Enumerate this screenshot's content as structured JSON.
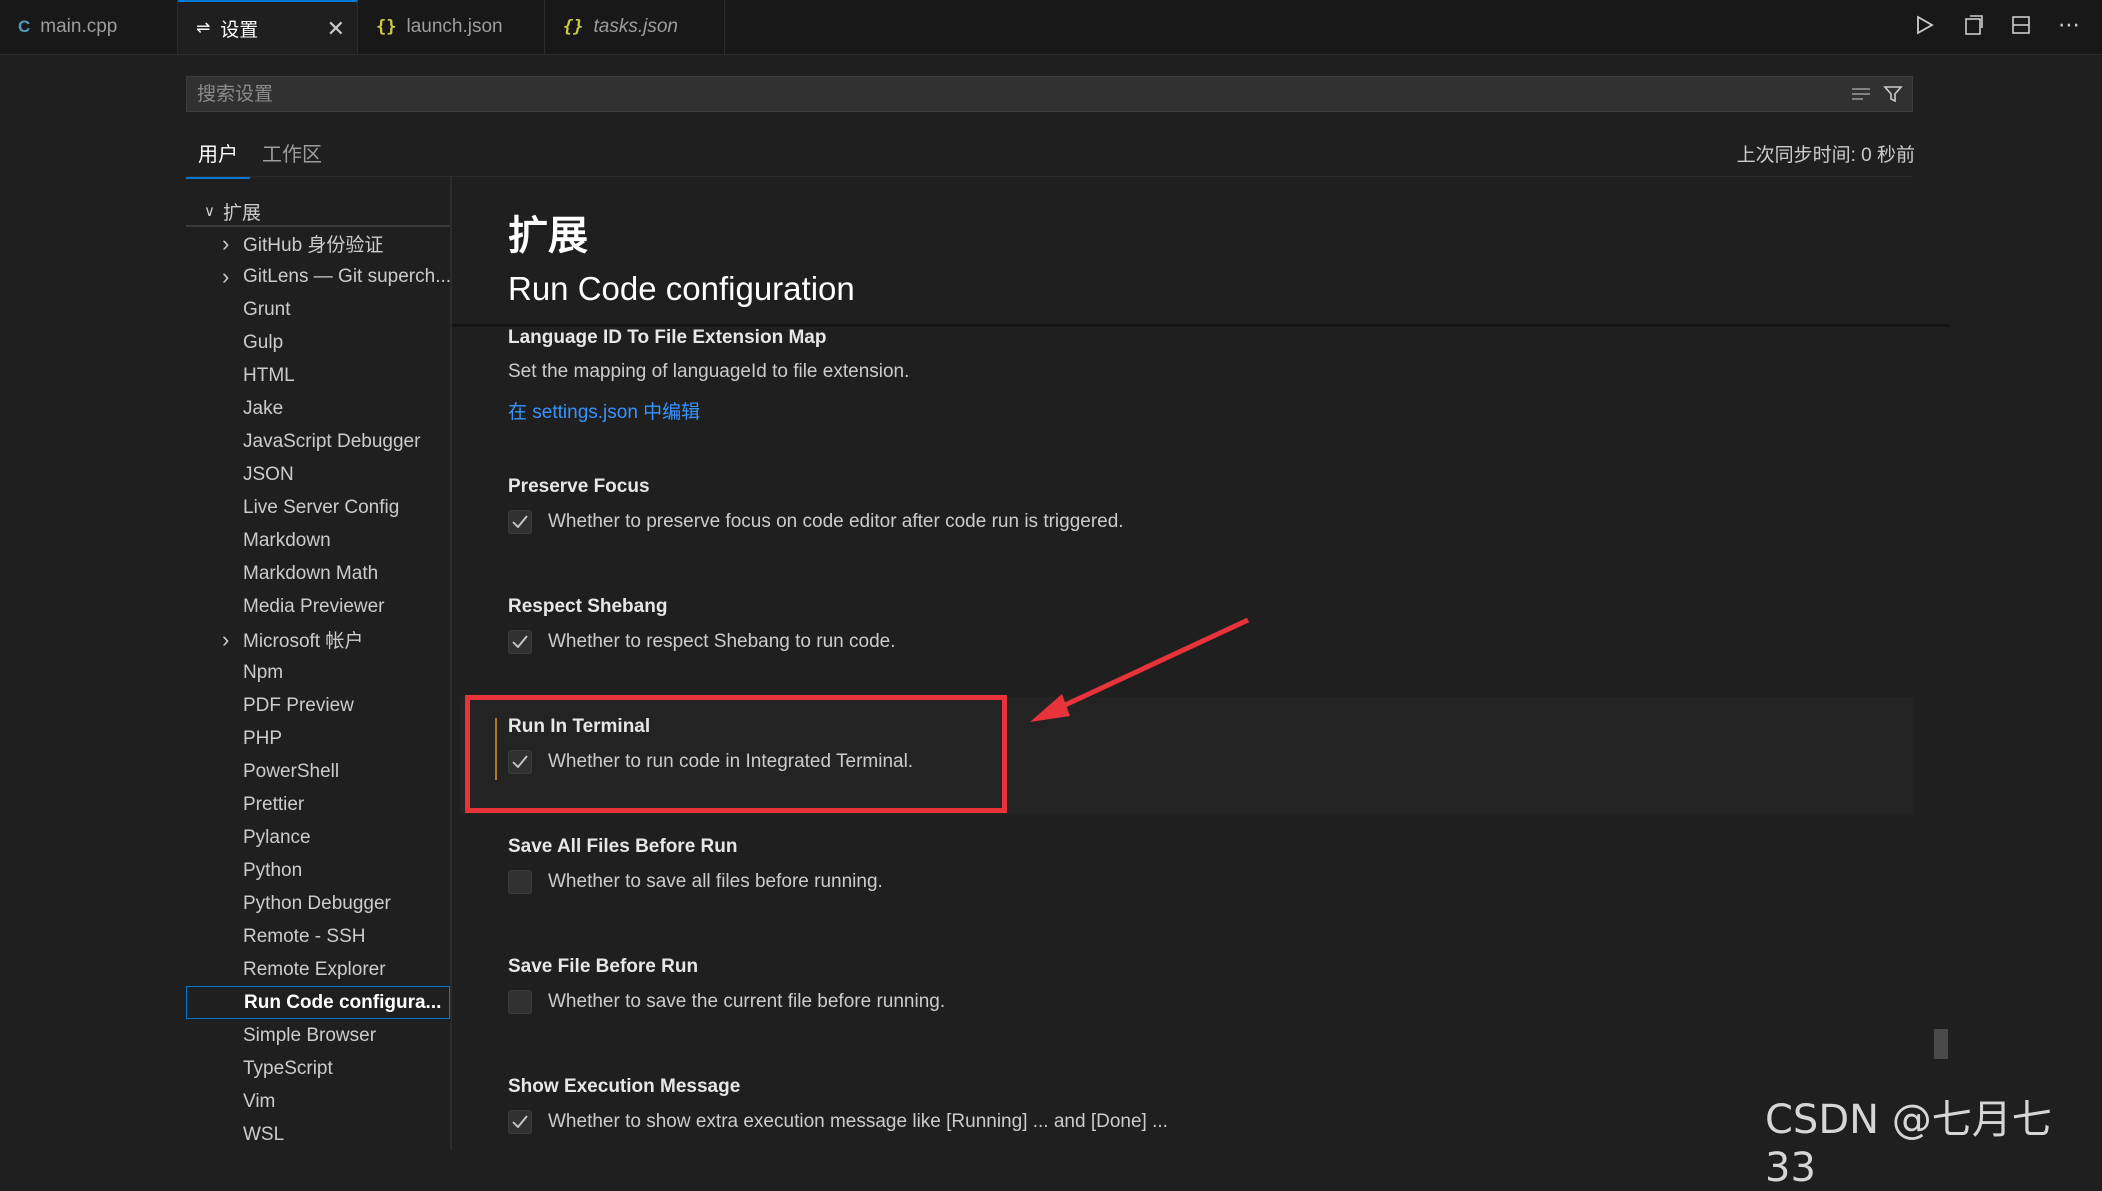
{
  "tabs": [
    {
      "label": "main.cpp",
      "icon": "cpp-file-icon"
    },
    {
      "label": "设置",
      "icon": "settings-sliders-icon",
      "active": true
    },
    {
      "label": "launch.json",
      "icon": "json-braces-icon"
    },
    {
      "label": "tasks.json",
      "icon": "json-braces-icon"
    }
  ],
  "search": {
    "placeholder": "搜索设置"
  },
  "scope_tabs": [
    "用户",
    "工作区"
  ],
  "sync_status": "上次同步时间: 0 秒前",
  "toc": {
    "group": "扩展",
    "items": [
      {
        "label": "GitHub 身份验证",
        "expandable": true
      },
      {
        "label": "GitLens — Git superch...",
        "expandable": true
      },
      {
        "label": "Grunt"
      },
      {
        "label": "Gulp"
      },
      {
        "label": "HTML"
      },
      {
        "label": "Jake"
      },
      {
        "label": "JavaScript Debugger"
      },
      {
        "label": "JSON"
      },
      {
        "label": "Live Server Config"
      },
      {
        "label": "Markdown"
      },
      {
        "label": "Markdown Math"
      },
      {
        "label": "Media Previewer"
      },
      {
        "label": "Microsoft 帐户",
        "expandable": true
      },
      {
        "label": "Npm"
      },
      {
        "label": "PDF Preview"
      },
      {
        "label": "PHP"
      },
      {
        "label": "PowerShell"
      },
      {
        "label": "Prettier"
      },
      {
        "label": "Pylance"
      },
      {
        "label": "Python"
      },
      {
        "label": "Python Debugger"
      },
      {
        "label": "Remote - SSH"
      },
      {
        "label": "Remote Explorer"
      },
      {
        "label": "Run Code configura...",
        "selected": true
      },
      {
        "label": "Simple Browser"
      },
      {
        "label": "TypeScript"
      },
      {
        "label": "Vim"
      },
      {
        "label": "WSL"
      }
    ]
  },
  "main": {
    "section_title": "扩展",
    "sub_title": "Run Code configuration",
    "settings": [
      {
        "title": "Language ID To File Extension Map",
        "description": "Set the mapping of languageId to file extension.",
        "link": "在 settings.json 中编辑"
      },
      {
        "title": "Preserve Focus",
        "description": "Whether to preserve focus on code editor after code run is triggered.",
        "checked": true
      },
      {
        "title": "Respect Shebang",
        "description": "Whether to respect Shebang to run code.",
        "checked": true
      },
      {
        "title": "Run In Terminal",
        "description": "Whether to run code in Integrated Terminal.",
        "checked": true
      },
      {
        "title": "Save All Files Before Run",
        "description": "Whether to save all files before running.",
        "checked": false
      },
      {
        "title": "Save File Before Run",
        "description": "Whether to save the current file before running.",
        "checked": false
      },
      {
        "title": "Show Execution Message",
        "description": "Whether to show extra execution message like [Running] ... and [Done] ...",
        "checked": true
      }
    ]
  },
  "watermark": "CSDN @七月七33",
  "colors": {
    "accent": "#0078d4",
    "highlight": "#e8333a",
    "link": "#3794ff"
  }
}
